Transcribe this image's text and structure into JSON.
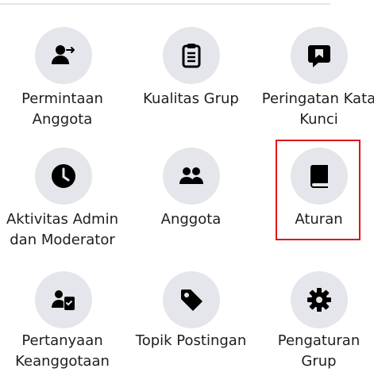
{
  "tiles": [
    {
      "line1": "Permintaan",
      "line2": "Anggota",
      "icon": "person-arrow-icon"
    },
    {
      "line1": "Kualitas Grup",
      "line2": "",
      "icon": "clipboard-icon"
    },
    {
      "line1": "Peringatan Kata",
      "line2": "Kunci",
      "icon": "speech-bubble-flag-icon"
    },
    {
      "line1": "Aktivitas Admin",
      "line2": "dan Moderator",
      "icon": "clock-icon"
    },
    {
      "line1": "Anggota",
      "line2": "",
      "icon": "people-icon"
    },
    {
      "line1": "Aturan",
      "line2": "",
      "icon": "book-icon"
    },
    {
      "line1": "Pertanyaan",
      "line2": "Keanggotaan",
      "icon": "person-checklist-icon"
    },
    {
      "line1": "Topik Postingan",
      "line2": "",
      "icon": "tag-icon"
    },
    {
      "line1": "Pengaturan",
      "line2": "Grup",
      "icon": "gear-icon"
    }
  ],
  "colors": {
    "icon": "#000000",
    "circle": "#e4e6eb",
    "highlight": "#e0131a"
  }
}
